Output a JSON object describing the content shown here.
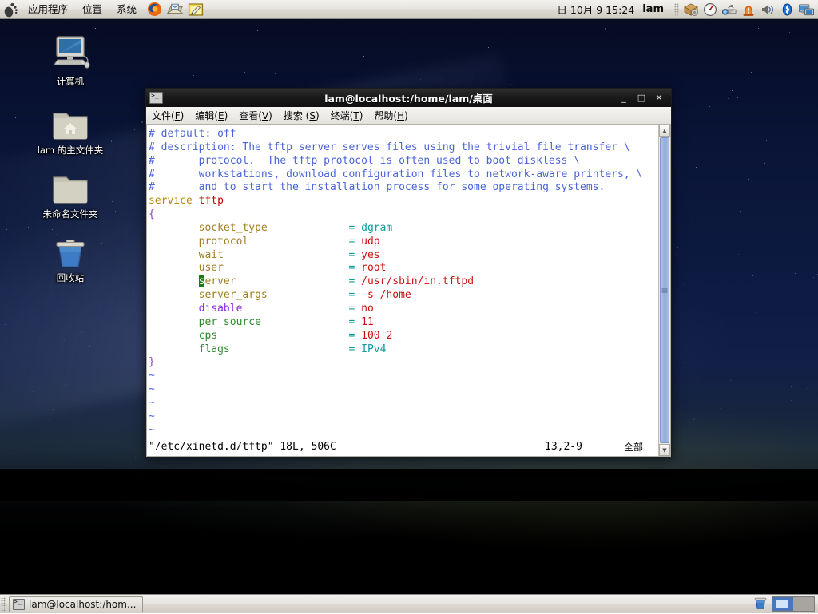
{
  "top_panel": {
    "foot_logo_icon": "gnome-foot-icon",
    "menus": [
      {
        "label": "应用程序",
        "name": "applications-menu"
      },
      {
        "label": "位置",
        "name": "places-menu"
      },
      {
        "label": "系统",
        "name": "system-menu"
      }
    ],
    "launchers": [
      {
        "name": "firefox-launcher-icon",
        "title": "Firefox"
      },
      {
        "name": "evolution-mail-launcher-icon",
        "title": "Evolution"
      },
      {
        "name": "text-editor-launcher-icon",
        "title": "gedit"
      }
    ],
    "clock": "日 10月  9 15:24",
    "username": "lam",
    "tray_icons": [
      {
        "name": "package-updater-icon"
      },
      {
        "name": "system-monitor-gauge-icon"
      },
      {
        "name": "network-manager-icon"
      },
      {
        "name": "alert-siren-icon"
      },
      {
        "name": "volume-speaker-icon"
      },
      {
        "name": "bluetooth-icon"
      },
      {
        "name": "display-settings-icon"
      }
    ]
  },
  "desktop": {
    "icons": [
      {
        "label": "计算机",
        "name": "desktop-icon-computer",
        "glyph": "computer-icon"
      },
      {
        "label": "lam 的主文件夹",
        "name": "desktop-icon-home",
        "glyph": "home-folder-icon"
      },
      {
        "label": "未命名文件夹",
        "name": "desktop-icon-untitled",
        "glyph": "folder-icon"
      },
      {
        "label": "回收站",
        "name": "desktop-icon-trash",
        "glyph": "trash-icon"
      }
    ]
  },
  "terminal": {
    "title": "lam@localhost:/home/lam/桌面",
    "window_icon": "terminal-icon",
    "buttons": {
      "minimize": "_",
      "maximize": "□",
      "close": "✕"
    },
    "menus": [
      {
        "text": "文件(F)",
        "pre": "文件(",
        "accel": "F",
        "post": ")",
        "name": "menu-file"
      },
      {
        "text": "编辑(E)",
        "pre": "编辑(",
        "accel": "E",
        "post": ")",
        "name": "menu-edit"
      },
      {
        "text": "查看(V)",
        "pre": "查看(",
        "accel": "V",
        "post": ")",
        "name": "menu-view"
      },
      {
        "text": "搜索 (S)",
        "pre": "搜索 (",
        "accel": "S",
        "post": ")",
        "name": "menu-search"
      },
      {
        "text": "终端(T)",
        "pre": "终端(",
        "accel": "T",
        "post": ")",
        "name": "menu-terminal"
      },
      {
        "text": "帮助(H)",
        "pre": "帮助(",
        "accel": "H",
        "post": ")",
        "name": "menu-help"
      }
    ],
    "status": {
      "file": "\"/etc/xinetd.d/tftp\" 18L, 506C",
      "position": "13,2-9",
      "scroll": "全部"
    },
    "editor": "vim",
    "file_lines": [
      "# default: off",
      "# description: The tftp server serves files using the trivial file transfer \\",
      "#       protocol.  The tftp protocol is often used to boot diskless \\",
      "#       workstations, download configuration files to network-aware printers, \\",
      "#       and to start the installation process for some operating systems.",
      "service tftp",
      "{",
      "        socket_type             = dgram",
      "        protocol                = udp",
      "        wait                    = yes",
      "        user                    = root",
      "        server                  = /usr/sbin/in.tftpd",
      "        server_args             = -s /home",
      "        disable                 = no",
      "        per_source              = 11",
      "        cps                     = 100 2",
      "        flags                   = IPv4",
      "}",
      "~",
      "~",
      "~",
      "~",
      "~"
    ],
    "config": {
      "service_keyword": "service",
      "service_name": "tftp",
      "entries": [
        {
          "key": "socket_type",
          "op": "=",
          "value": "dgram"
        },
        {
          "key": "protocol",
          "op": "=",
          "value": "udp"
        },
        {
          "key": "wait",
          "op": "=",
          "value": "yes"
        },
        {
          "key": "user",
          "op": "=",
          "value": "root"
        },
        {
          "key": "server",
          "op": "=",
          "value": "/usr/sbin/in.tftpd"
        },
        {
          "key": "server_args",
          "op": "=",
          "value": "-s /home"
        },
        {
          "key": "disable",
          "op": "=",
          "value": "no"
        },
        {
          "key": "per_source",
          "op": "=",
          "value": "11"
        },
        {
          "key": "cps",
          "op": "=",
          "value": "100 2"
        },
        {
          "key": "flags",
          "op": "=",
          "value": "IPv4"
        }
      ]
    },
    "cursor": {
      "line": 13,
      "column": 2,
      "char": "s"
    },
    "colors": {
      "comment": "#4a64d8",
      "keyword": "#b8860b",
      "type": "#cc0000",
      "value": "#cc1111",
      "operator": "#0f9b9b",
      "brace": "#9340c0",
      "cursor_bg": "#1a7a1a",
      "background": "#ffffff"
    }
  },
  "bottom_panel": {
    "task": {
      "label": "lam@localhost:/hom...",
      "icon": "terminal-icon"
    },
    "trash_icon": "trash-applet-icon",
    "workspaces": [
      {
        "name": "workspace-1",
        "active": true
      },
      {
        "name": "workspace-2",
        "active": false
      }
    ]
  }
}
